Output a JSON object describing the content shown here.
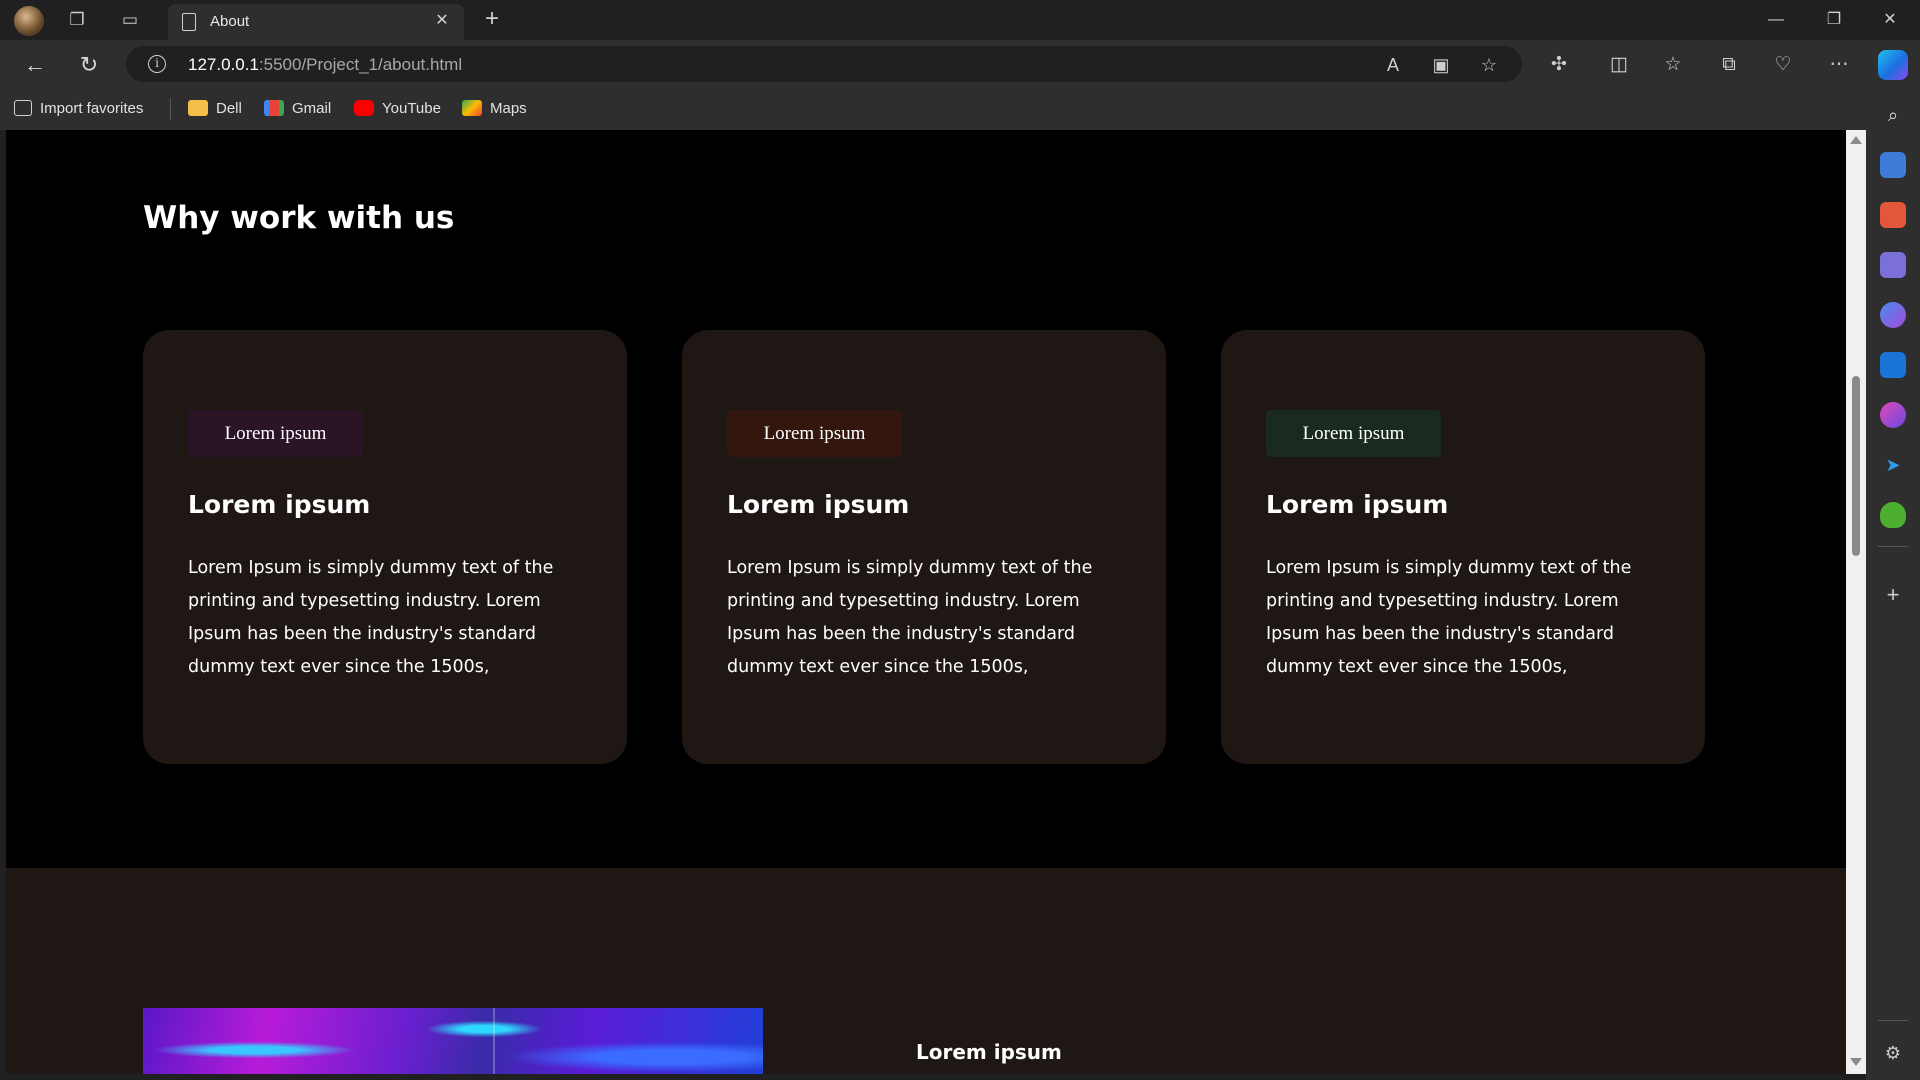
{
  "browser": {
    "tab_title": "About",
    "url_host": "127.0.0.1",
    "url_rest": ":5500/Project_1/about.html",
    "bookmarks": [
      {
        "label": "Import favorites",
        "icon": "import-icon"
      },
      {
        "label": "Dell",
        "icon": "folder-icon"
      },
      {
        "label": "Gmail",
        "icon": "gmail-icon"
      },
      {
        "label": "YouTube",
        "icon": "youtube-icon"
      },
      {
        "label": "Maps",
        "icon": "maps-icon"
      }
    ]
  },
  "page": {
    "heading": "Why work with us",
    "cards": [
      {
        "chip": "Lorem ipsum",
        "chip_color": "#2a1426",
        "title": "Lorem ipsum",
        "text": "Lorem Ipsum is simply dummy text of the printing and typesetting industry. Lorem Ipsum has been the industry's standard dummy text ever since the 1500s,"
      },
      {
        "chip": "Lorem ipsum",
        "chip_color": "#33170f",
        "title": "Lorem ipsum",
        "text": "Lorem Ipsum is simply dummy text of the printing and typesetting industry. Lorem Ipsum has been the industry's standard dummy text ever since the 1500s,"
      },
      {
        "chip": "Lorem ipsum",
        "chip_color": "#1a2a1f",
        "title": "Lorem ipsum",
        "text": "Lorem Ipsum is simply dummy text of the printing and typesetting industry. Lorem Ipsum has been the industry's standard dummy text ever since the 1500s,"
      }
    ],
    "lower_title": "Lorem ipsum"
  },
  "colors": {
    "page_bg": "#000000",
    "card_bg": "#1e1714",
    "section_bg": "#1e1714"
  }
}
